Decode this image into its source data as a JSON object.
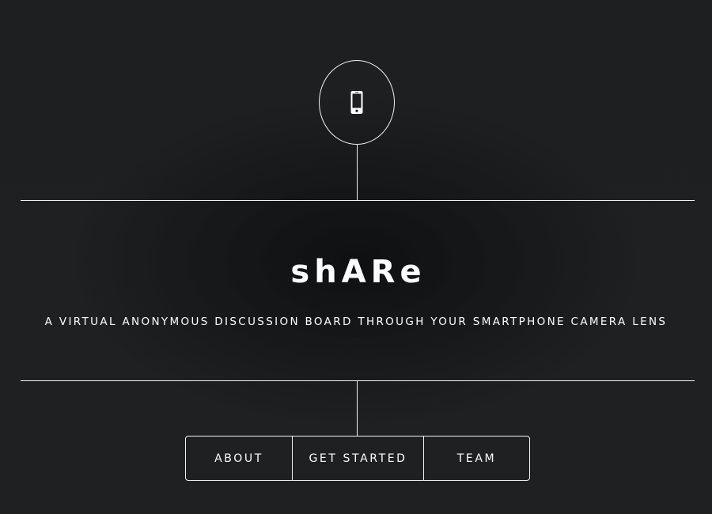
{
  "logo": {
    "icon": "smartphone-icon"
  },
  "hero": {
    "title": "shARe",
    "tagline": "A VIRTUAL ANONYMOUS DISCUSSION BOARD THROUGH YOUR SMARTPHONE CAMERA LENS"
  },
  "nav": {
    "items": [
      {
        "label": "ABOUT"
      },
      {
        "label": "GET STARTED"
      },
      {
        "label": "TEAM"
      }
    ]
  },
  "colors": {
    "background": "#1d1f21",
    "foreground": "#ffffff",
    "line": "#f2f2f2"
  }
}
